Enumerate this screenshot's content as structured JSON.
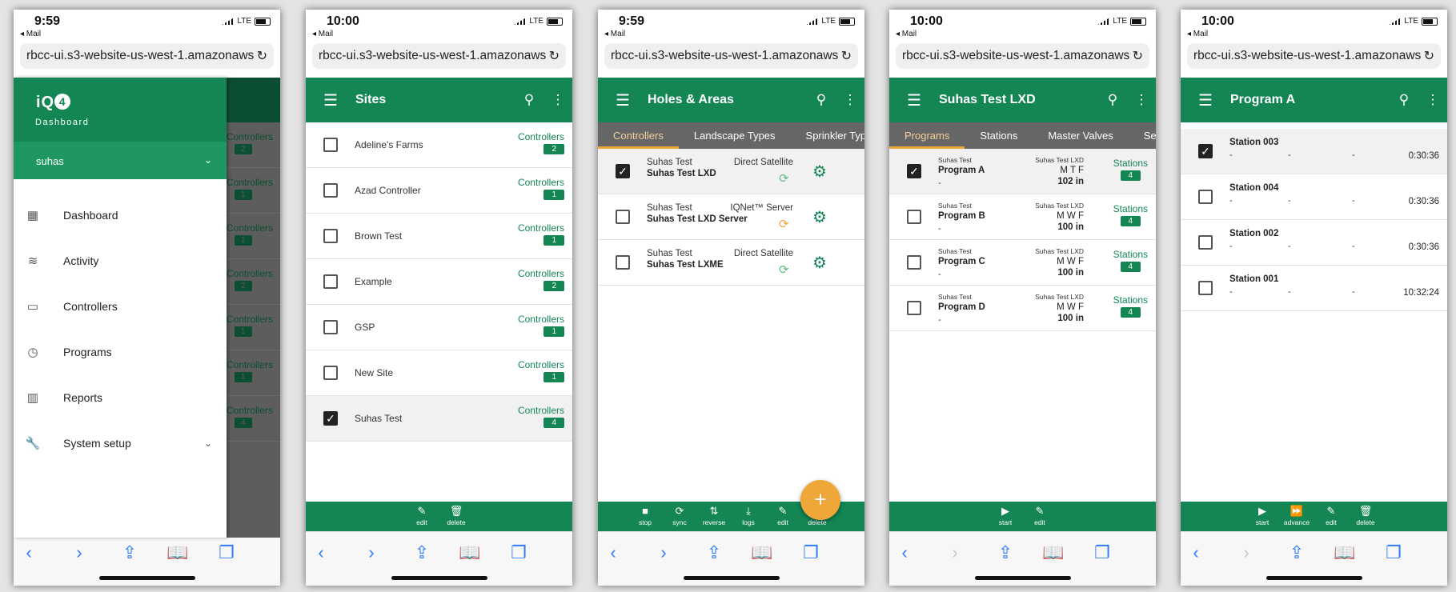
{
  "url": "rbcc-ui.s3-website-us-west-1.amazonaws.com",
  "mail_label": "◂ Mail",
  "network": "LTE",
  "screens": {
    "drawer": {
      "time": "9:59",
      "logo_text": "iQ",
      "logo_digit": "4",
      "subtitle": "Dashboard",
      "user": "suhas",
      "items": [
        {
          "label": "Dashboard",
          "icon": "dashboard-icon"
        },
        {
          "label": "Activity",
          "icon": "activity-icon"
        },
        {
          "label": "Controllers",
          "icon": "controller-icon"
        },
        {
          "label": "Programs",
          "icon": "timer-icon"
        },
        {
          "label": "Reports",
          "icon": "reports-icon"
        },
        {
          "label": "System setup",
          "icon": "wrench-icon"
        }
      ],
      "behind_label": "Controllers",
      "behind_counts": [
        "2",
        "1",
        "1",
        "2",
        "1",
        "1",
        "4"
      ]
    },
    "sites": {
      "time": "10:00",
      "title": "Sites",
      "controllers_label": "Controllers",
      "rows": [
        {
          "name": "Adeline's Farms",
          "count": "2",
          "checked": false
        },
        {
          "name": "Azad Controller",
          "count": "1",
          "checked": false
        },
        {
          "name": "Brown Test",
          "count": "1",
          "checked": false
        },
        {
          "name": "Example",
          "count": "2",
          "checked": false
        },
        {
          "name": "GSP",
          "count": "1",
          "checked": false
        },
        {
          "name": "New Site",
          "count": "1",
          "checked": false
        },
        {
          "name": "Suhas Test",
          "count": "4",
          "checked": true
        }
      ],
      "actions": [
        {
          "label": "edit",
          "icon": "✎"
        },
        {
          "label": "delete",
          "icon": "🗑"
        }
      ]
    },
    "holes": {
      "time": "9:59",
      "title": "Holes & Areas",
      "tabs": [
        "Controllers",
        "Landscape Types",
        "Sprinkler Types"
      ],
      "rows": [
        {
          "site": "Suhas Test",
          "name": "Suhas Test LXD",
          "type": "Direct Satellite",
          "sync_color": "#5fbf80",
          "checked": true
        },
        {
          "site": "Suhas Test",
          "name": "Suhas Test LXD Server",
          "type": "IQNet™ Server",
          "sync_color": "#f0a73a",
          "checked": false
        },
        {
          "site": "Suhas Test",
          "name": "Suhas Test LXME",
          "type": "Direct Satellite",
          "sync_color": "#5fbf80",
          "checked": false
        }
      ],
      "fab": "+",
      "actions": [
        {
          "label": "stop",
          "icon": "■"
        },
        {
          "label": "sync",
          "icon": "⟳"
        },
        {
          "label": "reverse",
          "icon": "⇅"
        },
        {
          "label": "logs",
          "icon": "⤓"
        },
        {
          "label": "edit",
          "icon": "✎"
        },
        {
          "label": "delete",
          "icon": "🗑"
        }
      ]
    },
    "programs": {
      "time": "10:00",
      "title": "Suhas Test LXD",
      "tabs": [
        "Programs",
        "Stations",
        "Master Valves",
        "Se"
      ],
      "stations_label": "Stations",
      "rows": [
        {
          "site": "Suhas Test",
          "name": "Program A",
          "dash": "-",
          "controller": "Suhas Test LXD",
          "days": "M T F",
          "amount": "102 in",
          "count": "4",
          "checked": true
        },
        {
          "site": "Suhas Test",
          "name": "Program B",
          "dash": "-",
          "controller": "Suhas Test LXD",
          "days": "M W F",
          "amount": "100 in",
          "count": "4",
          "checked": false
        },
        {
          "site": "Suhas Test",
          "name": "Program C",
          "dash": "-",
          "controller": "Suhas Test LXD",
          "days": "M W F",
          "amount": "100 in",
          "count": "4",
          "checked": false
        },
        {
          "site": "Suhas Test",
          "name": "Program D",
          "dash": "-",
          "controller": "Suhas Test LXD",
          "days": "M W F",
          "amount": "100 in",
          "count": "4",
          "checked": false
        }
      ],
      "actions": [
        {
          "label": "start",
          "icon": "▶"
        },
        {
          "label": "edit",
          "icon": "✎"
        }
      ]
    },
    "stations": {
      "time": "10:00",
      "title": "Program A",
      "rows": [
        {
          "name": "Station 003",
          "d1": "-",
          "d2": "-",
          "d3": "-",
          "time": "0:30:36",
          "checked": true
        },
        {
          "name": "Station 004",
          "d1": "-",
          "d2": "-",
          "d3": "-",
          "time": "0:30:36",
          "checked": false
        },
        {
          "name": "Station 002",
          "d1": "-",
          "d2": "-",
          "d3": "-",
          "time": "0:30:36",
          "checked": false
        },
        {
          "name": "Station 001",
          "d1": "-",
          "d2": "-",
          "d3": "-",
          "time": "10:32:24",
          "checked": false
        }
      ],
      "actions": [
        {
          "label": "start",
          "icon": "▶"
        },
        {
          "label": "advance",
          "icon": "⏩"
        },
        {
          "label": "edit",
          "icon": "✎"
        },
        {
          "label": "delete",
          "icon": "🗑"
        }
      ]
    }
  },
  "safari_buttons": [
    "‹",
    "›",
    "⇪",
    "📖",
    "❐"
  ]
}
